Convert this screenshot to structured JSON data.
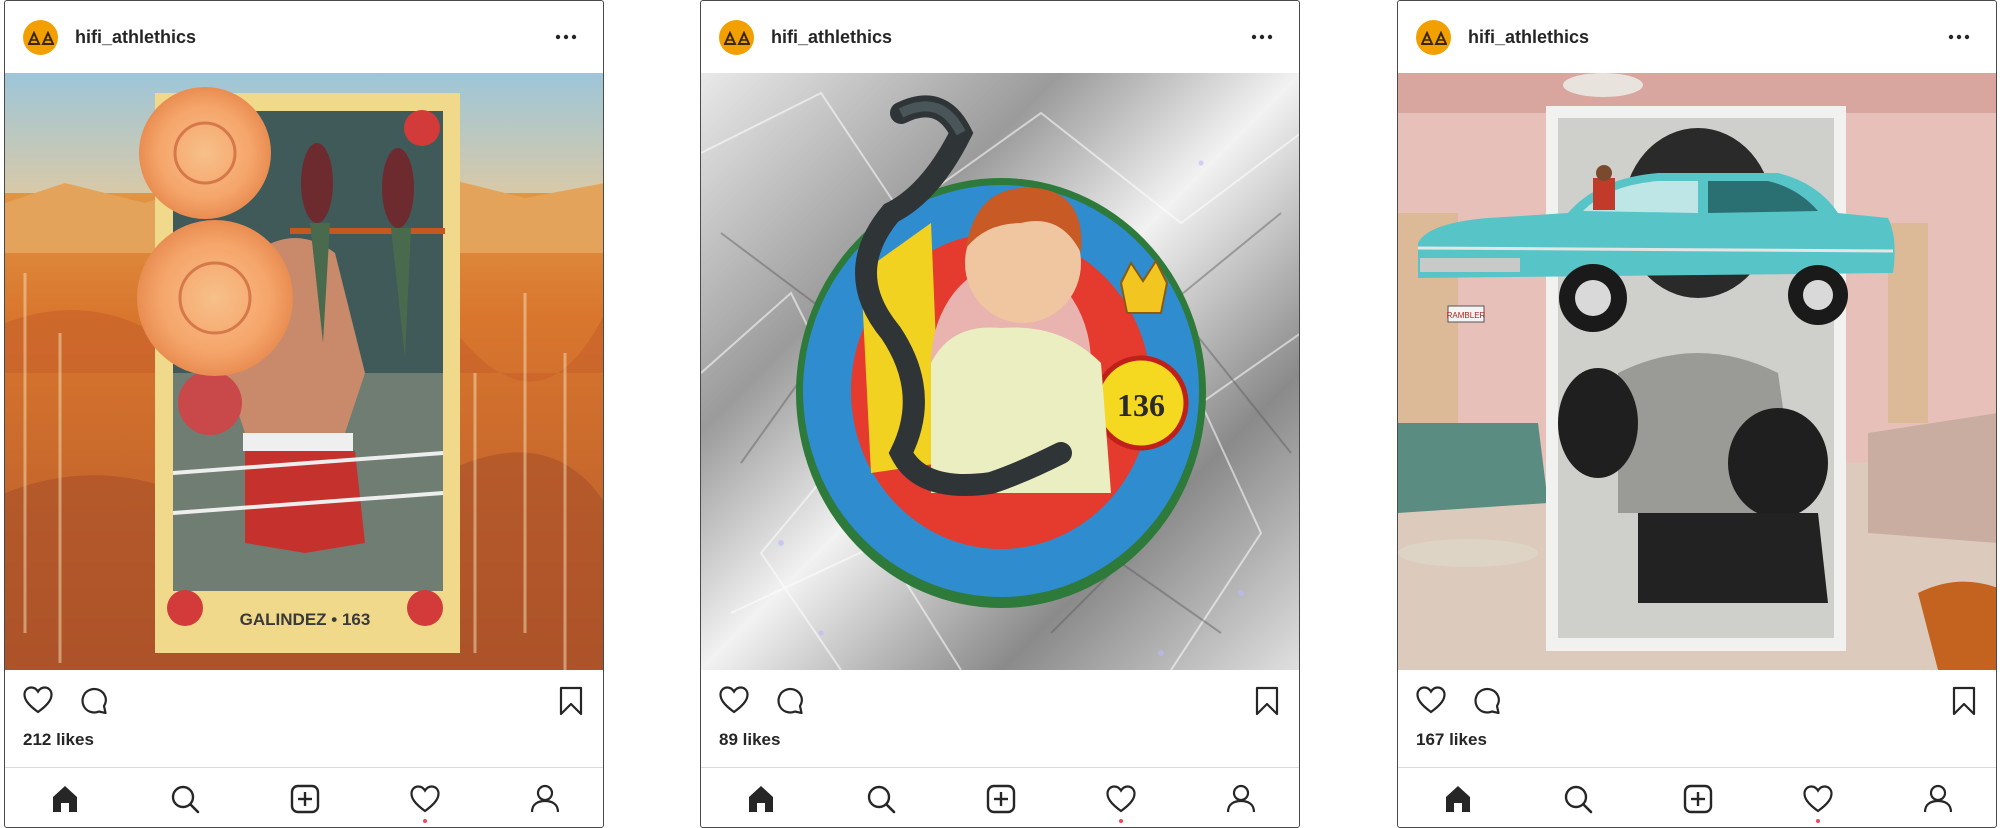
{
  "accent_color": "#f2a000",
  "notification_dot_color": "#ed4956",
  "posts": [
    {
      "username": "hifi_athlethics",
      "likes": "212 likes",
      "image": {
        "subject": "vintage trading card collage with roses and parrots over canyon landscape",
        "card_caption": "GALINDEZ • 163"
      }
    },
    {
      "username": "hifi_athlethics",
      "likes": "89 likes",
      "image": {
        "subject": "vintage woman holding a snake on a round badge over silver foil",
        "badge_number": "136"
      }
    },
    {
      "username": "hifi_athlethics",
      "likes": "167 likes",
      "image": {
        "subject": "boxer photo with a turquoise vintage car over a pink living room",
        "plate_text": "RAMBLER"
      }
    }
  ],
  "icons": {
    "more": "more-options-icon",
    "like": "heart-icon",
    "comment": "comment-icon",
    "save": "bookmark-icon",
    "home": "home-icon",
    "search": "search-icon",
    "add": "add-post-icon",
    "activity": "heart-icon",
    "profile": "profile-icon"
  }
}
